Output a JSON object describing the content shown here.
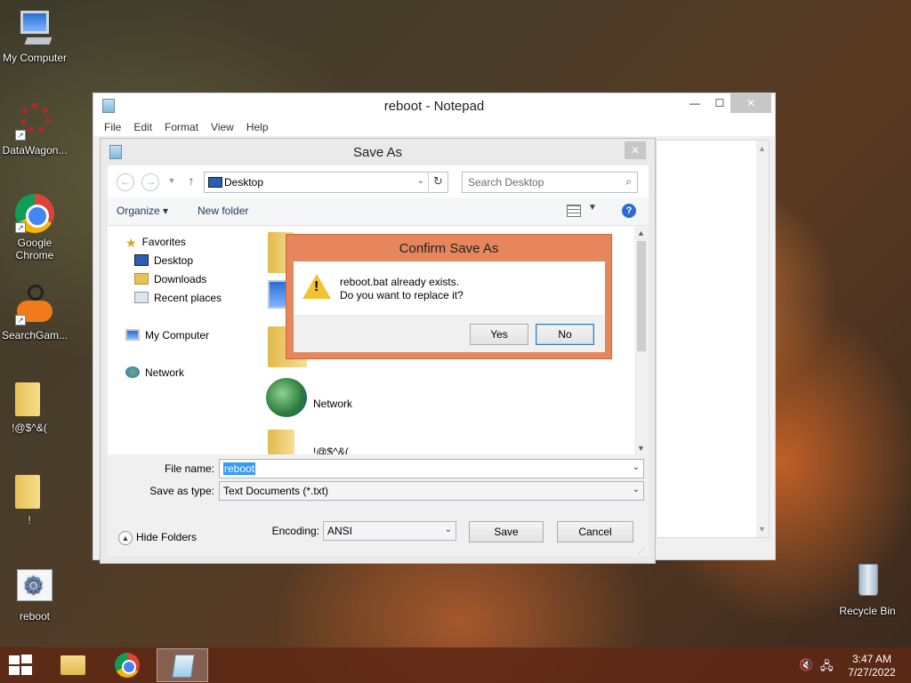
{
  "desktop": {
    "icons": [
      {
        "label": "My Computer"
      },
      {
        "label": "DataWagon..."
      },
      {
        "label": "Google Chrome"
      },
      {
        "label": "SearchGam..."
      },
      {
        "label": "!@$^&("
      },
      {
        "label": "!"
      },
      {
        "label": "reboot"
      },
      {
        "label": "Recycle Bin"
      }
    ]
  },
  "notepad": {
    "title": "reboot - Notepad",
    "menu": [
      "File",
      "Edit",
      "Format",
      "View",
      "Help"
    ],
    "controls": {
      "minimize": "—",
      "maximize": "☐",
      "close": "✕"
    }
  },
  "saveas": {
    "title": "Save As",
    "close": "✕",
    "address": "Desktop",
    "search_placeholder": "Search Desktop",
    "toolbar": {
      "organize": "Organize ▾",
      "new_folder": "New folder"
    },
    "navpane": {
      "favorites": "Favorites",
      "desktop": "Desktop",
      "downloads": "Downloads",
      "recent": "Recent places",
      "my_computer": "My Computer",
      "network": "Network"
    },
    "files": {
      "network": "Network",
      "partial": "!@$^&("
    },
    "file_name_label": "File name:",
    "file_name_value": "reboot",
    "save_type_label": "Save as type:",
    "save_type_value": "Text Documents (*.txt)",
    "hide_folders": "Hide Folders",
    "encoding_label": "Encoding:",
    "encoding_value": "ANSI",
    "save_button": "Save",
    "cancel_button": "Cancel"
  },
  "confirm": {
    "title": "Confirm Save As",
    "line1": "reboot.bat already exists.",
    "line2": "Do you want to replace it?",
    "yes": "Yes",
    "no": "No"
  },
  "taskbar": {
    "time": "3:47 AM",
    "date": "7/27/2022"
  }
}
